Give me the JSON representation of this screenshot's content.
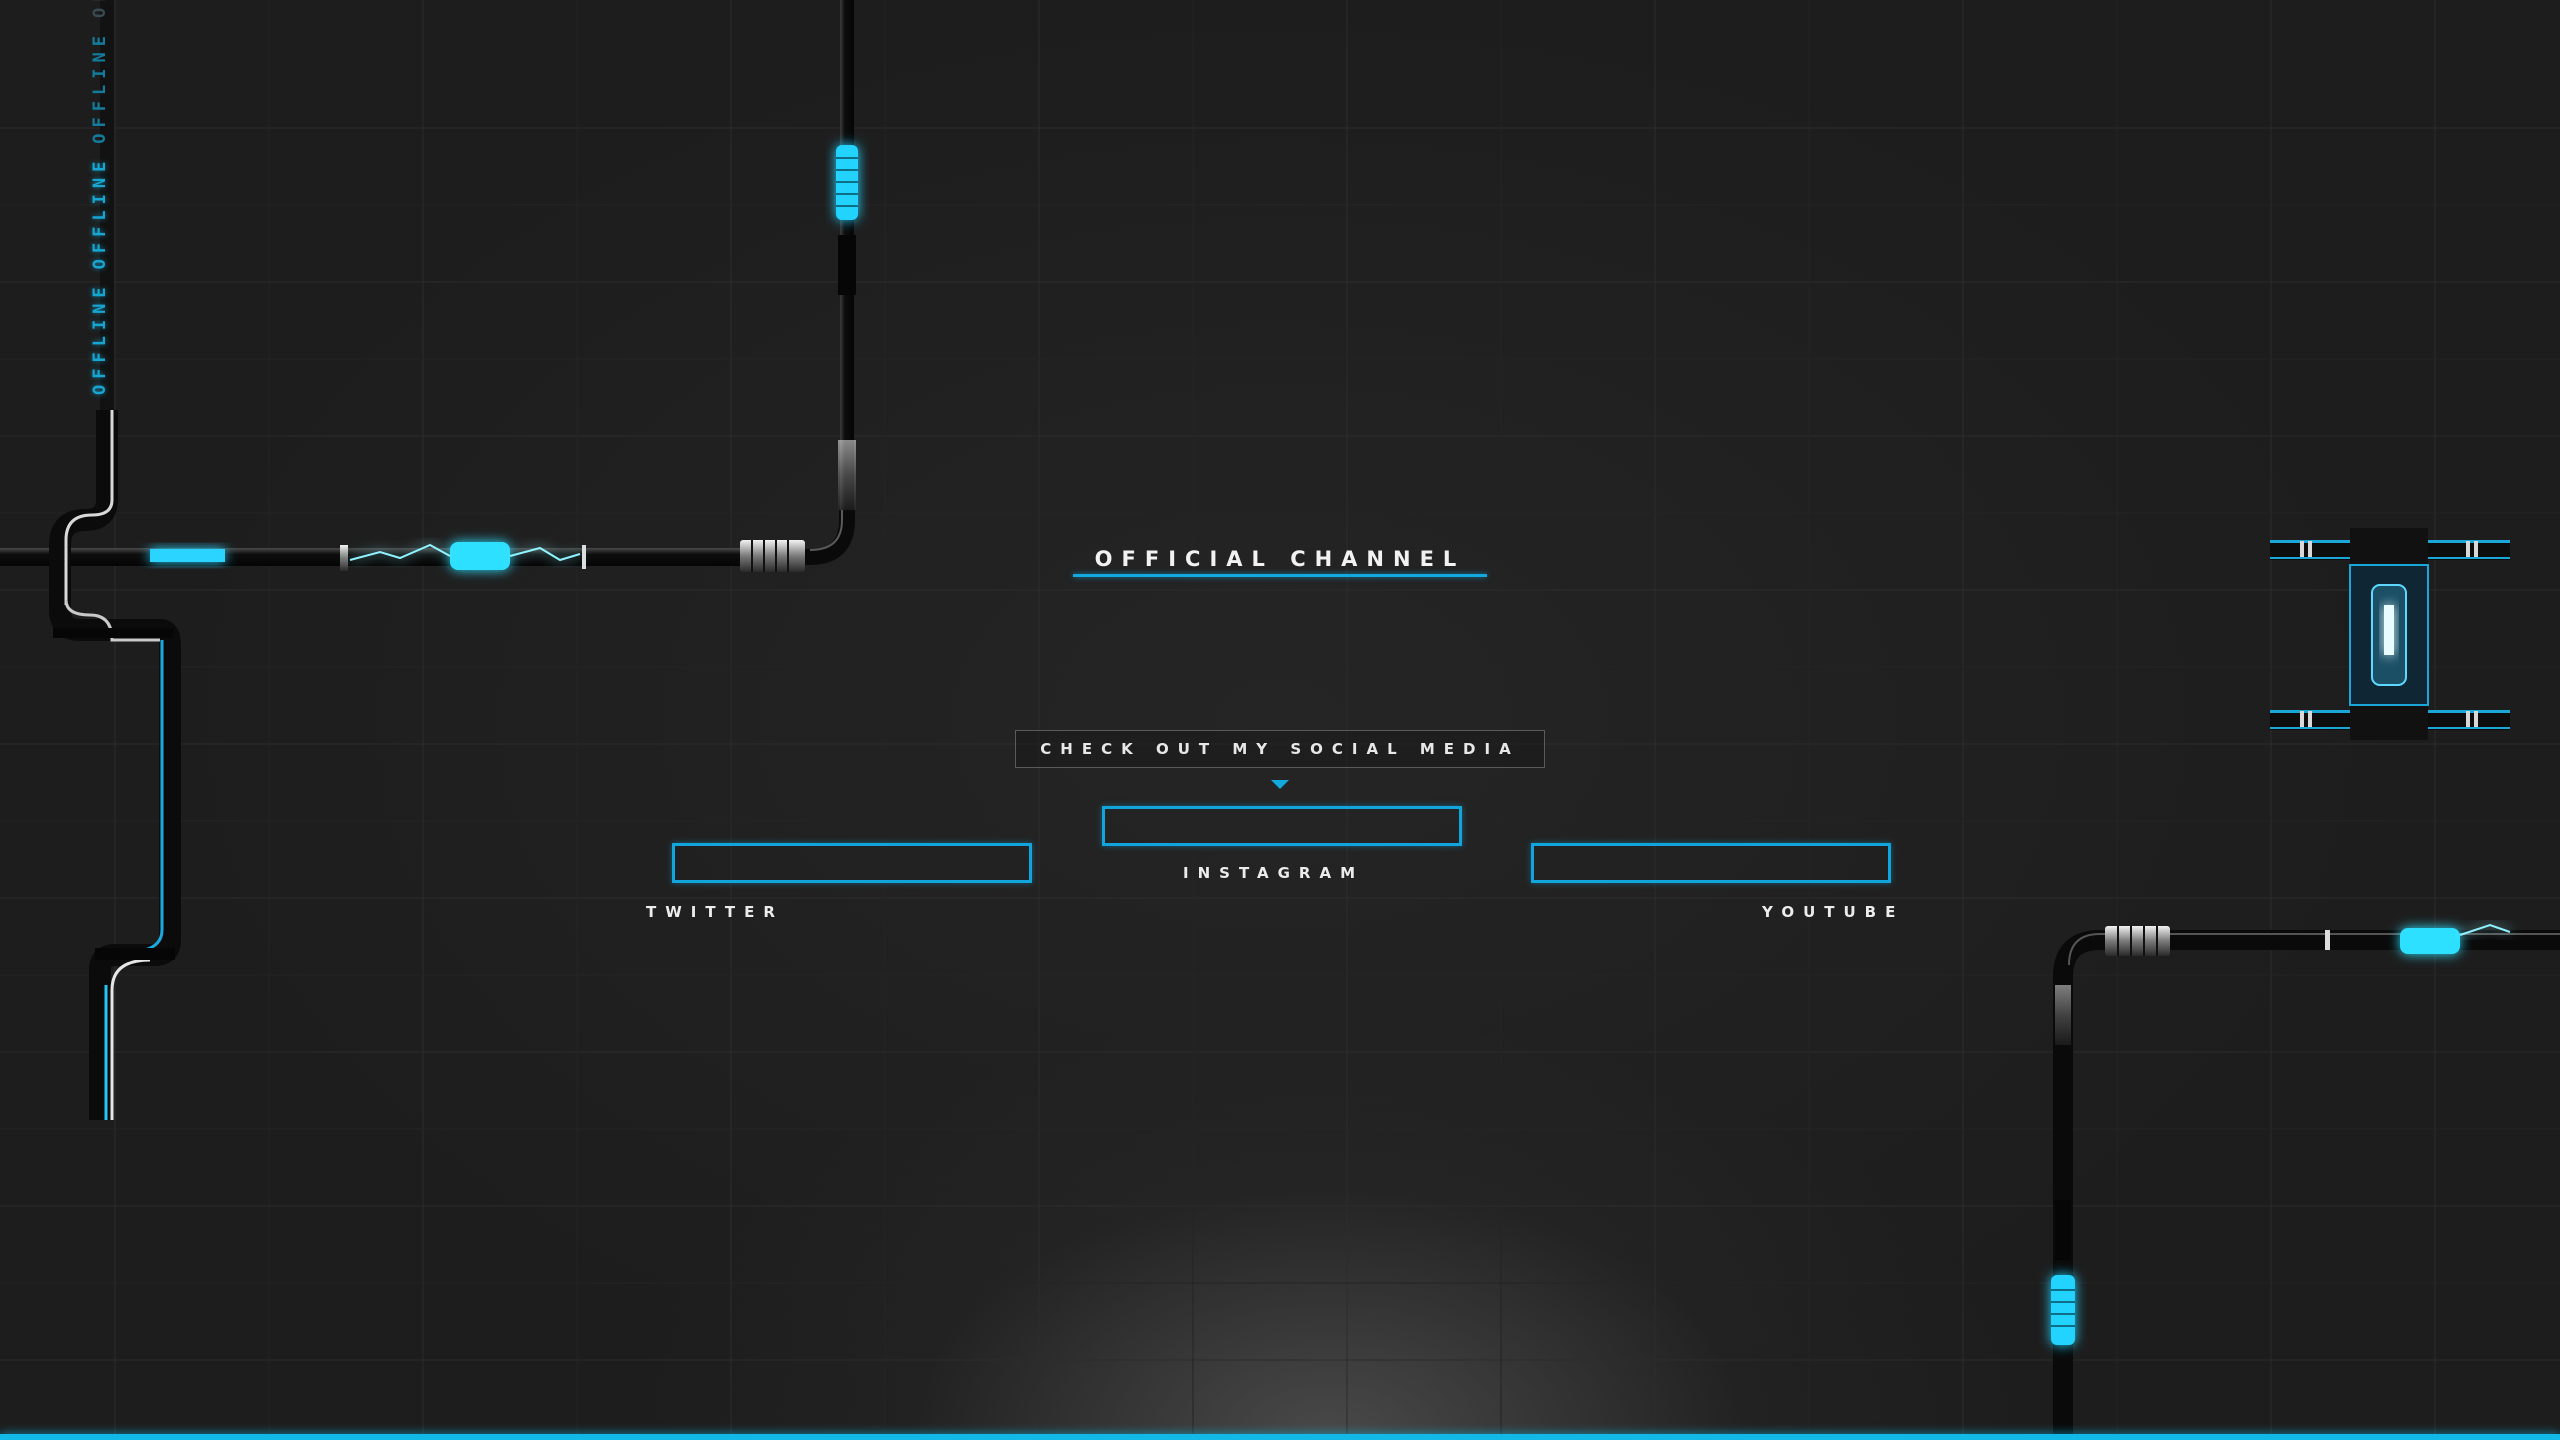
{
  "background": {
    "color": "#202020",
    "accent_color": "#12b8e6"
  },
  "side_text": {
    "words": [
      "OFFLINE",
      "OFFLINE",
      "OFFLINE",
      "OFFLINE"
    ]
  },
  "title": {
    "text": "OFFICIAL CHANNEL"
  },
  "social": {
    "header": "CHECK OUT MY SOCIAL MEDIA",
    "links": [
      {
        "id": "twitter",
        "label": "TWITTER"
      },
      {
        "id": "instagram",
        "label": "INSTAGRAM"
      },
      {
        "id": "youtube",
        "label": "YOUTUBE"
      }
    ]
  },
  "icons": {
    "caret": "caret-down-icon",
    "pipes": "neon-pipe-decoration"
  }
}
